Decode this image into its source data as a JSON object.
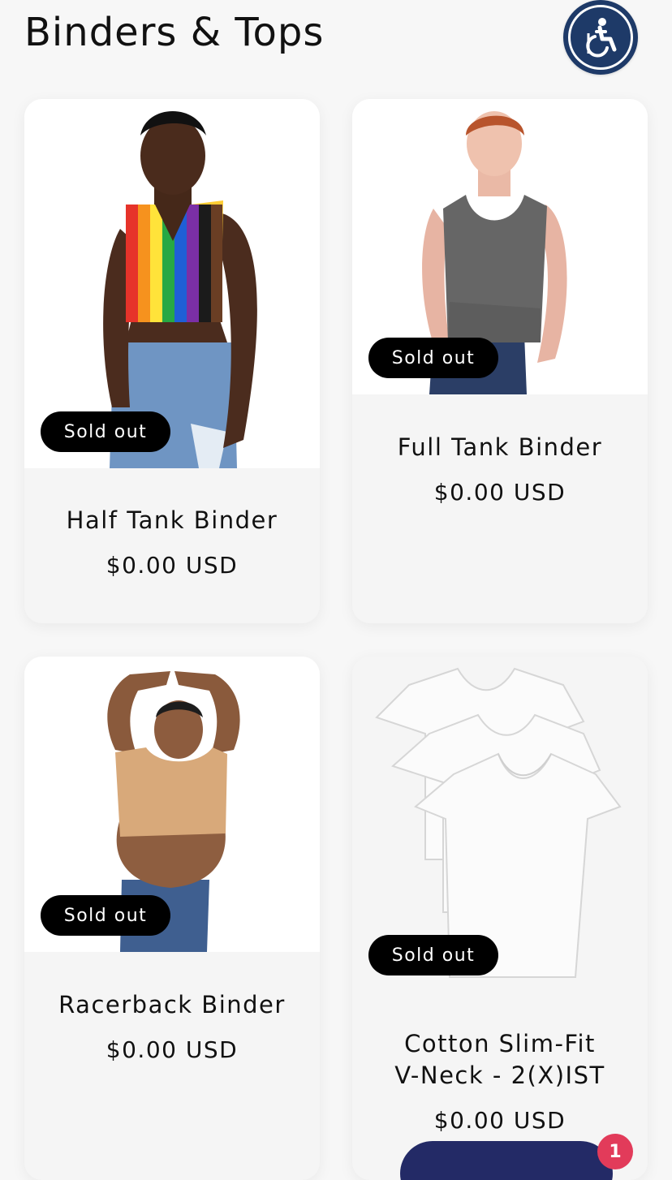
{
  "header": {
    "title": "Binders & Tops",
    "accessibility_icon": "accessibility-icon"
  },
  "products": [
    {
      "name": "Half Tank Binder",
      "price": "$0.00 USD",
      "badge": "Sold out",
      "image": "person-rainbow-binder-image"
    },
    {
      "name": "Full Tank Binder",
      "price": "$0.00 USD",
      "badge": "Sold out",
      "image": "person-gray-binder-image"
    },
    {
      "name": "Racerback Binder",
      "price": "$0.00 USD",
      "badge": "Sold out",
      "image": "person-tan-binder-image"
    },
    {
      "name_line1": "Cotton Slim-Fit",
      "name_line2": "V-Neck - 2(X)IST",
      "price": "$0.00 USD",
      "badge": "Sold out",
      "image": "white-tshirts-image"
    }
  ],
  "chat": {
    "notification_count": "1"
  },
  "colors": {
    "accessibility_bg": "#1e3a68",
    "badge_bg": "#000000",
    "chat_bg": "#232a66",
    "notification_bg": "#e23b5a"
  }
}
